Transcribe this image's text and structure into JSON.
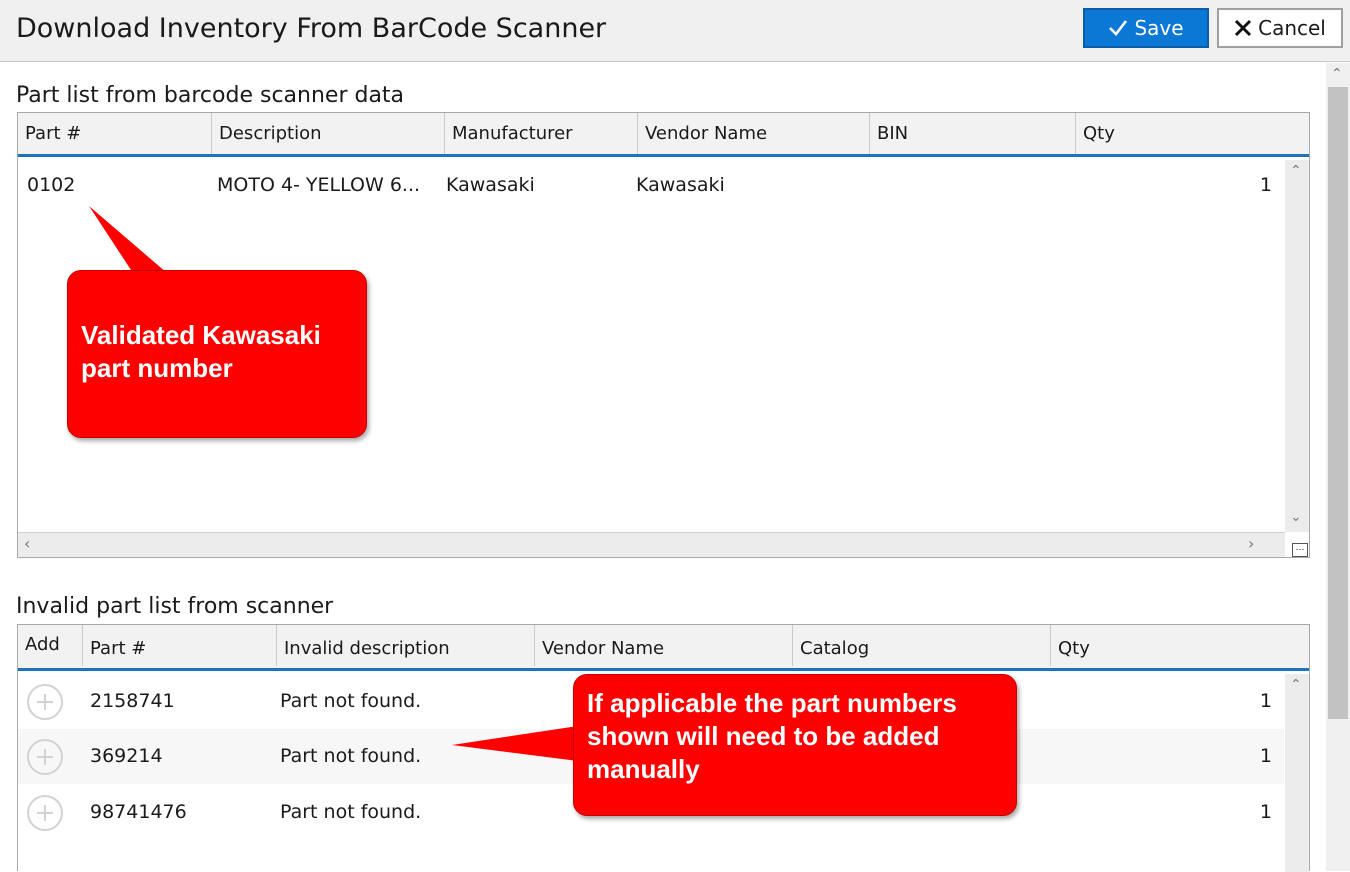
{
  "window": {
    "title": "Download Inventory From BarCode Scanner",
    "save_label": "Save",
    "cancel_label": "Cancel"
  },
  "valid_section": {
    "label": "Part list from barcode scanner data",
    "columns": [
      "Part #",
      "Description",
      "Manufacturer",
      "Vendor Name",
      "BIN",
      "Qty"
    ],
    "rows": [
      {
        "part": "0102",
        "description": "MOTO 4- YELLOW 6...",
        "manufacturer": "Kawasaki",
        "vendor": "Kawasaki",
        "bin": "",
        "qty": "1"
      }
    ]
  },
  "invalid_section": {
    "label": "Invalid part list from scanner",
    "columns": [
      "Add",
      "Part #",
      "Invalid description",
      "Vendor Name",
      "Catalog",
      "Qty"
    ],
    "rows": [
      {
        "part": "2158741",
        "description": "Part not found.",
        "qty": "1"
      },
      {
        "part": "369214",
        "description": "Part not found.",
        "qty": "1"
      },
      {
        "part": "98741476",
        "description": "Part not found.",
        "qty": "1"
      }
    ]
  },
  "callouts": {
    "validated": "Validated Kawasaki part number",
    "manual": "If applicable the part numbers shown will need to be added manually"
  },
  "colors": {
    "accent": "#0a78d4",
    "callout": "#ff0000"
  }
}
